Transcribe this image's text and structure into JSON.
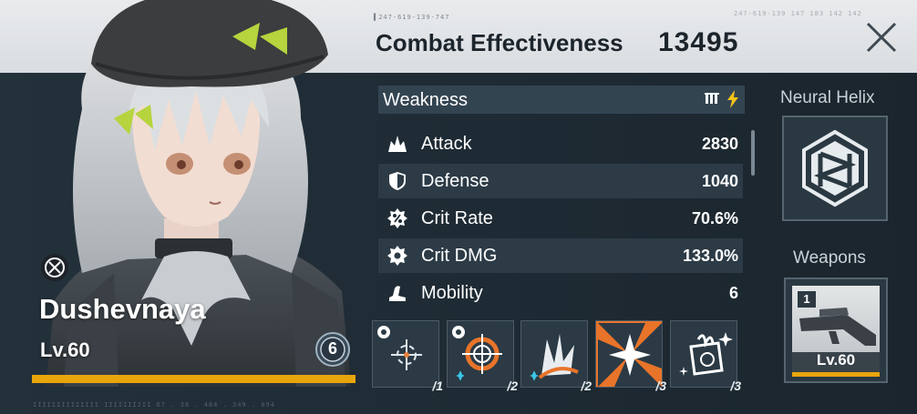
{
  "header": {
    "code_left": "▌247-619-139-747",
    "code_right": "247-619-139 147 183 142 142",
    "title": "Combat Effectiveness",
    "value": "13495"
  },
  "character": {
    "name": "Dushevnaya",
    "level": "Lv.60",
    "rank": "6"
  },
  "weakness": {
    "label": "Weakness"
  },
  "stats": [
    {
      "label": "Attack",
      "value": "2830",
      "icon": "attack-icon"
    },
    {
      "label": "Defense",
      "value": "1040",
      "icon": "defense-icon"
    },
    {
      "label": "Crit Rate",
      "value": "70.6%",
      "icon": "crit-rate-icon"
    },
    {
      "label": "Crit DMG",
      "value": "133.0%",
      "icon": "crit-dmg-icon"
    },
    {
      "label": "Mobility",
      "value": "6",
      "icon": "mobility-icon"
    }
  ],
  "skills": [
    {
      "level": "/1"
    },
    {
      "level": "/2"
    },
    {
      "level": "/2"
    },
    {
      "level": "/3"
    },
    {
      "level": "/3"
    }
  ],
  "neural_helix": {
    "title": "Neural Helix"
  },
  "weapons": {
    "title": "Weapons",
    "count": "1",
    "level": "Lv.60"
  },
  "footer": {
    "code": "IIIIIIIIIIIIII IIIIIIIIII 67 . 38 . 484 . 349 . 094"
  },
  "colors": {
    "accent_gold": "#e8a50c",
    "weakness_yellow": "#f3c21a",
    "panel": "#1e2a33"
  }
}
